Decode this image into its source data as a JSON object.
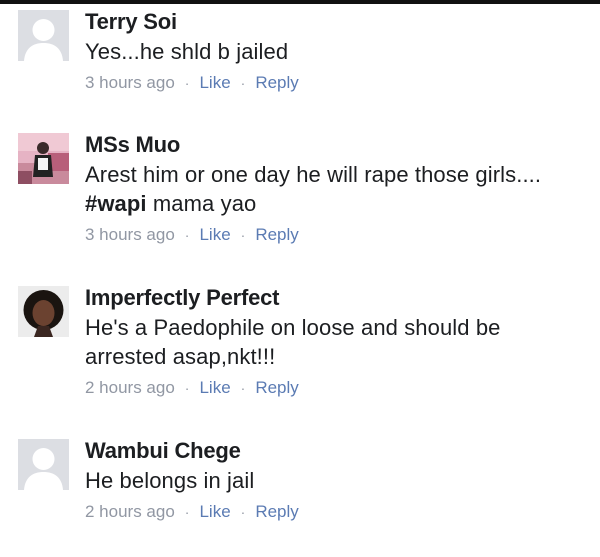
{
  "comments": [
    {
      "author": "Terry Soi",
      "lines": [
        "Yes...he shld b jailed"
      ],
      "time": "3 hours ago",
      "like": "Like",
      "reply": "Reply",
      "avatar": "default-silhouette"
    },
    {
      "author": "MSs Muo",
      "line1": "Arest him or one day he will rape those girls....",
      "hashtag": "#wapi",
      "line2_rest": " mama yao",
      "time": "3 hours ago",
      "like": "Like",
      "reply": "Reply",
      "avatar": "photo"
    },
    {
      "author": "Imperfectly Perfect",
      "lines": [
        "He's a Paedophile on loose and should be",
        "arrested asap,nkt!!!"
      ],
      "time": "2 hours ago",
      "like": "Like",
      "reply": "Reply",
      "avatar": "photo"
    },
    {
      "author": "Wambui Chege",
      "lines": [
        "He belongs in jail"
      ],
      "time": "2 hours ago",
      "like": "Like",
      "reply": "Reply",
      "avatar": "default-silhouette"
    }
  ],
  "separator": "·",
  "colors": {
    "text": "#1c1e21",
    "meta": "#9197a3",
    "link": "#5b7bb3",
    "silhouette_bg": "#dcdee3"
  }
}
